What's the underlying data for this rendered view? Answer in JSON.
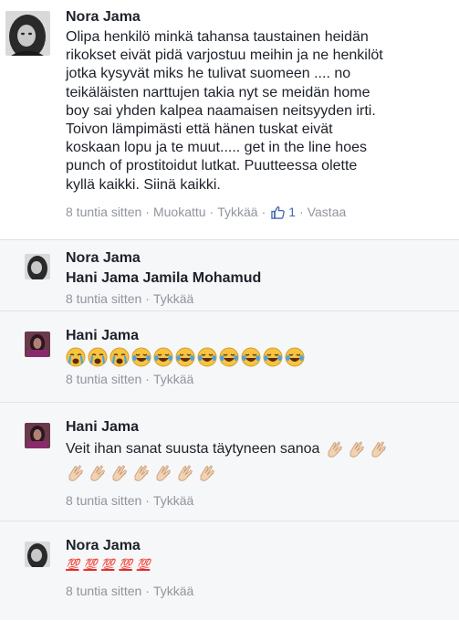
{
  "main": {
    "name": "Nora Jama",
    "text": "Olipa henkilö minkä tahansa taustainen heidän\nrikokset eivät pidä varjostuu meihin ja ne henkilöt\njotka kysyvät miks he tulivat suomeen .... no\nteikäläisten narttujen takia nyt se meidän home\nboy sai yhden kalpea naamaisen neitsyyden irti.\nToivon lämpimästi että hänen tuskat eivät\nkoskaan lopu ja te muut..... get in the line hoes\npunch of prostitoidut lutkat. Puutteessa olette\nkyllä kaikki. Siinä kaikki.",
    "time": "8 tuntia sitten",
    "edited": "Muokattu",
    "like": "Tykkää",
    "like_count": "1",
    "reply": "Vastaa",
    "sep": "·"
  },
  "replies": [
    {
      "name": "Nora Jama",
      "tags": "Hani Jama Jamila Mohamud",
      "time": "8 tuntia sitten",
      "like": "Tykkää"
    },
    {
      "name": "Hani Jama",
      "emoji": [
        "crying-face",
        "crying-face",
        "crying-face",
        "tears-of-joy",
        "tears-of-joy",
        "tears-of-joy",
        "tears-of-joy",
        "tears-of-joy",
        "tears-of-joy",
        "tears-of-joy"
      ],
      "time": "8 tuntia sitten",
      "like": "Tykkää"
    },
    {
      "name": "Hani Jama",
      "text": "Veit ihan sanat suusta täytyneen sanoa",
      "emoji": [
        "clapping-hands",
        "clapping-hands",
        "clapping-hands",
        "clapping-hands",
        "clapping-hands",
        "clapping-hands",
        "clapping-hands",
        "clapping-hands",
        "clapping-hands",
        "clapping-hands"
      ],
      "time": "8 tuntia sitten",
      "like": "Tykkää"
    },
    {
      "name": "Nora Jama",
      "emoji_text": "💯",
      "emoji": [
        "hundred-points",
        "hundred-points",
        "hundred-points",
        "hundred-points",
        "hundred-points"
      ],
      "time": "8 tuntia sitten",
      "like": "Tykkää"
    }
  ],
  "colors": {
    "reply_bg": "#f6f7f9",
    "meta_text": "#90949c",
    "link_blue": "#4267b2",
    "hundred_red": "#e0262b"
  }
}
